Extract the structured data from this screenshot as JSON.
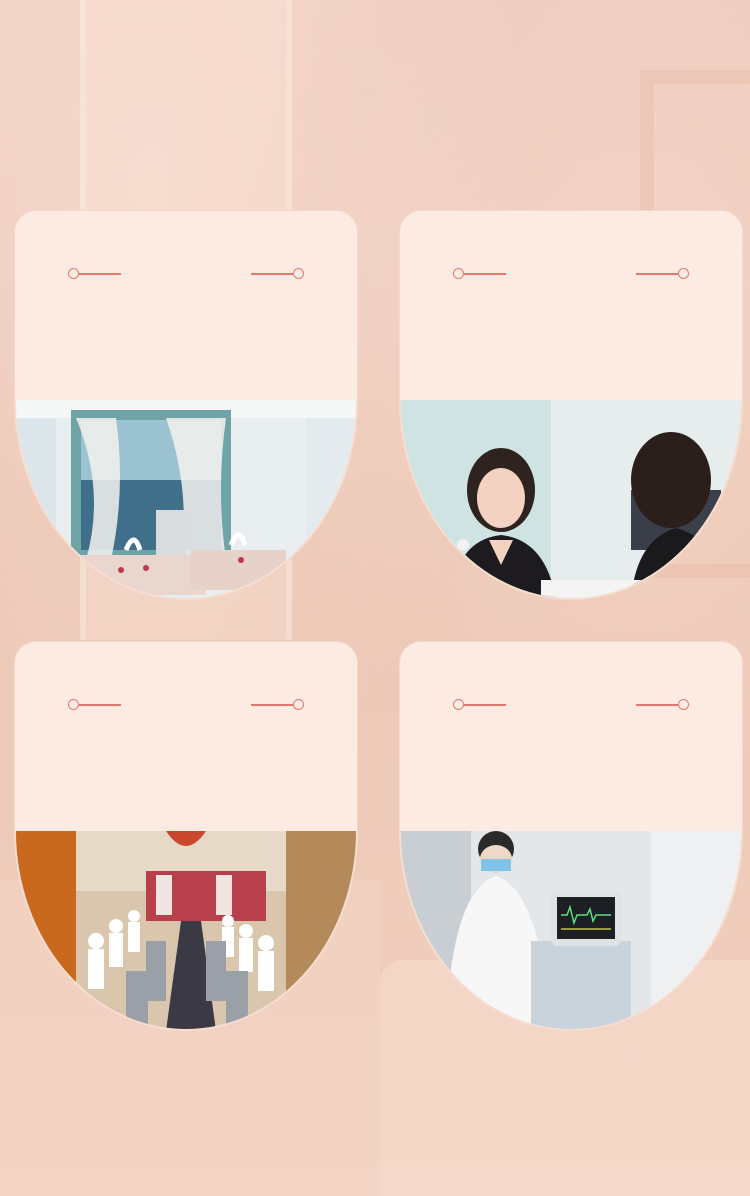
{
  "page": {
    "background_color": "#f0cdbd",
    "accent": "#e07a70"
  },
  "cards": [
    {
      "id": "card-1",
      "photo": "treatment-room-photo",
      "photo_desc_icon": "room-photo"
    },
    {
      "id": "card-2",
      "photo": "consultation-photo",
      "photo_desc_icon": "consultation-photo"
    },
    {
      "id": "card-3",
      "photo": "training-hall-photo",
      "photo_desc_icon": "training-photo"
    },
    {
      "id": "card-4",
      "photo": "medical-monitor-photo",
      "photo_desc_icon": "monitor-photo"
    }
  ]
}
